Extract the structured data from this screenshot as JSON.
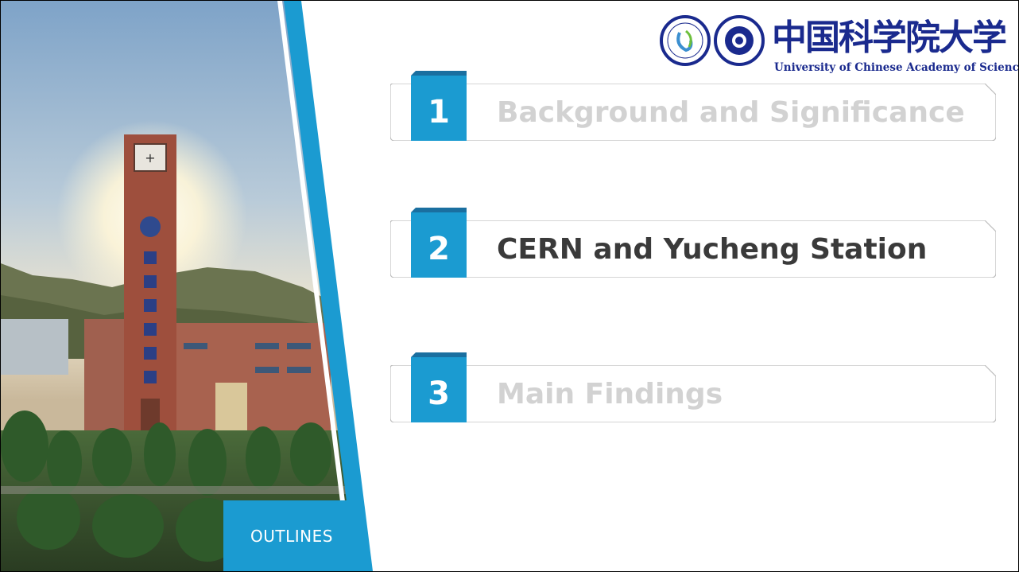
{
  "sidebar": {
    "photo": "campus-clock-tower-photo",
    "outline_label": "OUTLINES"
  },
  "logo": {
    "name_cn": "中国科学院大学",
    "name_en": "University of Chinese Academy of Sciences"
  },
  "outline": {
    "items": [
      {
        "number": "1",
        "title": "Background and Significance",
        "state": "dim"
      },
      {
        "number": "2",
        "title": "CERN and Yucheng Station",
        "state": "active"
      },
      {
        "number": "3",
        "title": "Main Findings",
        "state": "dim"
      }
    ]
  },
  "colors": {
    "accent": "#1b9bd1",
    "active_text": "#3a3a3a",
    "dim_text": "#d2d2d2",
    "logo_blue": "#1a2a8e"
  }
}
